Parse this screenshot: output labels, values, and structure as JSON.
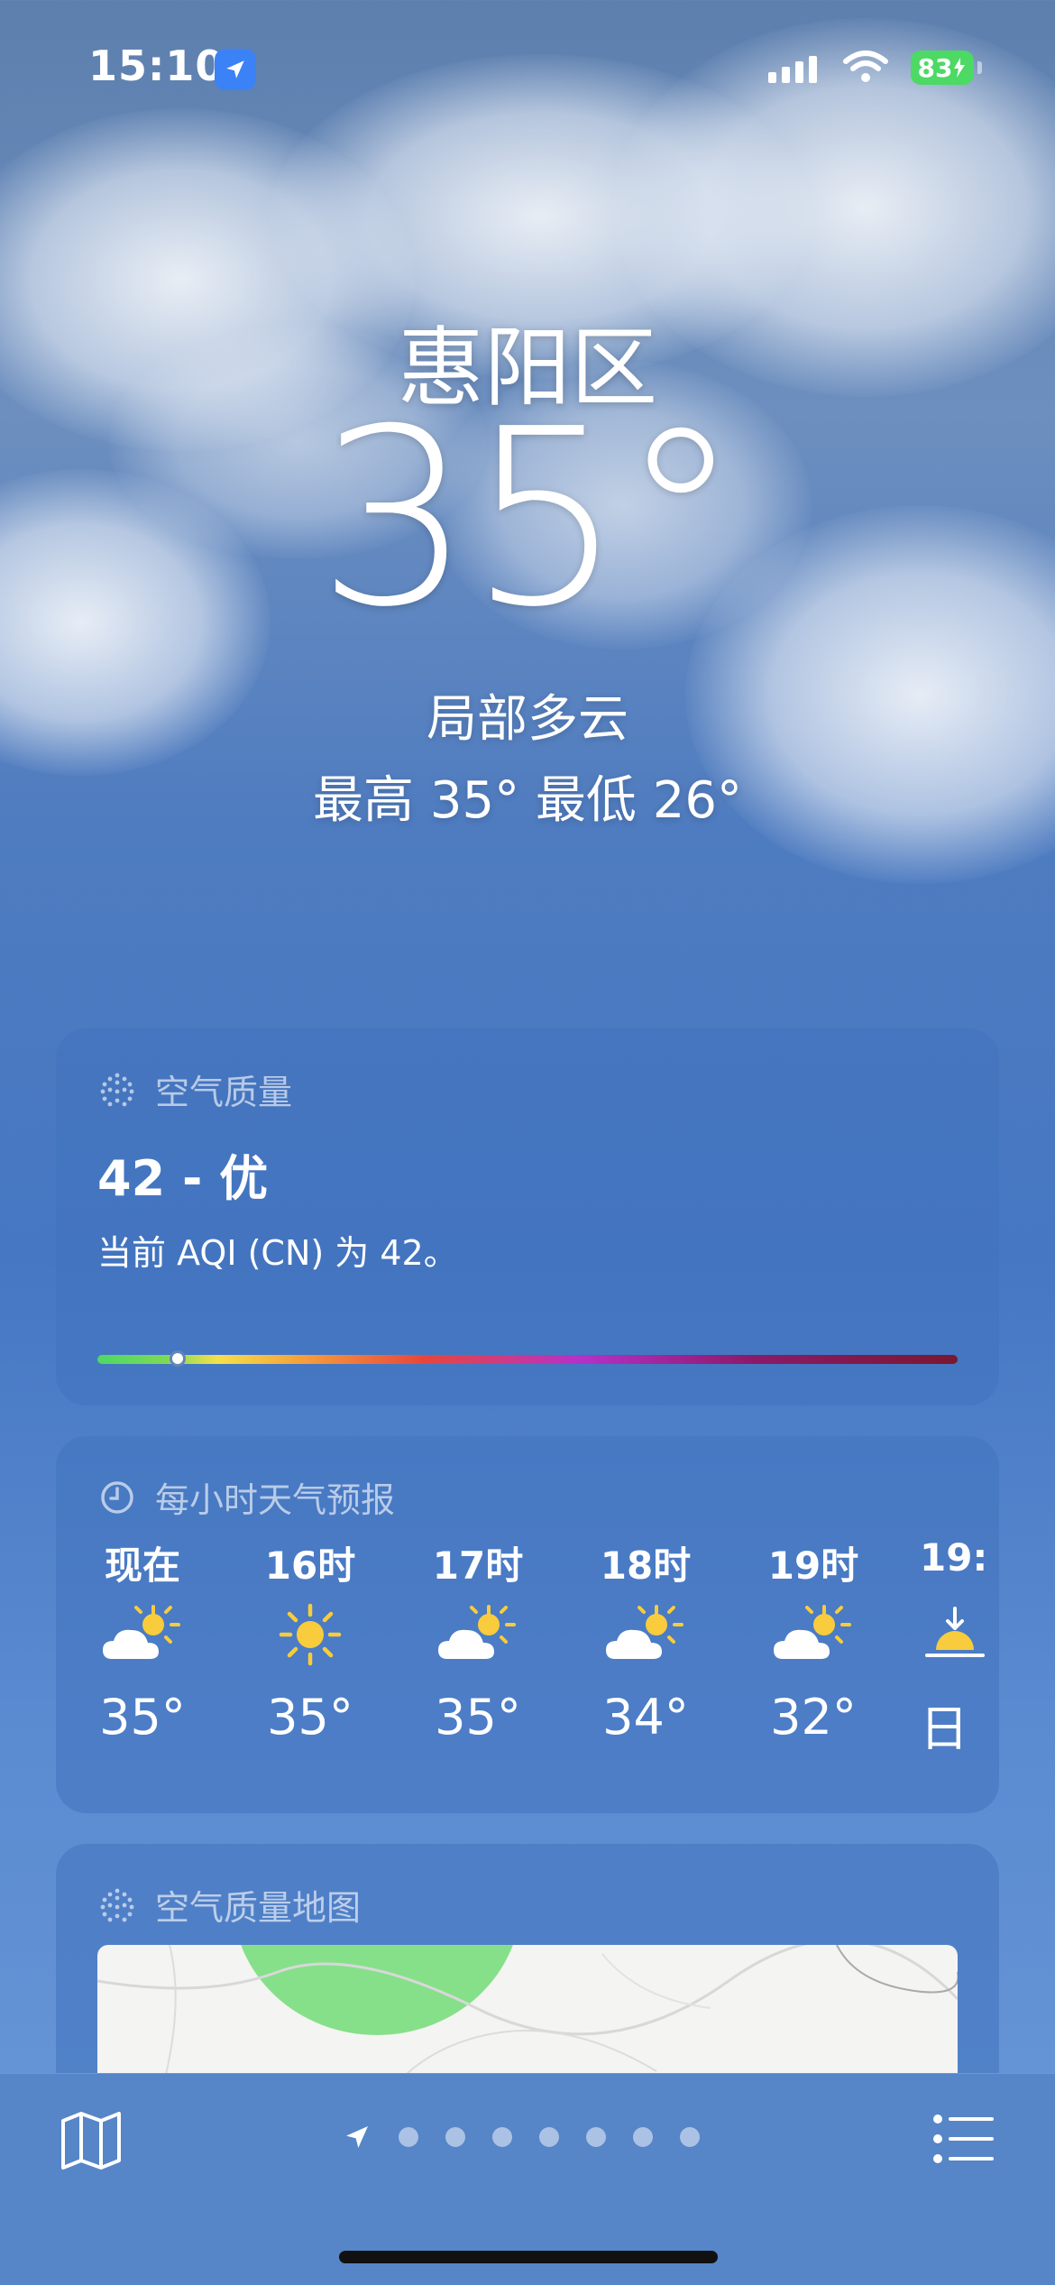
{
  "status_bar": {
    "time": "15:10",
    "battery": "83",
    "location_icon": "location-arrow-icon",
    "signal_icon": "cellular-signal-icon",
    "wifi_icon": "wifi-icon",
    "battery_icon": "battery-charging-icon",
    "battery_color": "#4cd964"
  },
  "current": {
    "city": "惠阳区",
    "temperature": "35°",
    "condition": "局部多云",
    "high_low": "最高 35°  最低 26°"
  },
  "air_quality": {
    "header": "空气质量",
    "icon": "air-quality-icon",
    "value": "42 - 优",
    "description": "当前 AQI (CN) 为 42。",
    "aqi": 42
  },
  "hourly": {
    "header": "每小时天气预报",
    "icon": "clock-icon",
    "items": [
      {
        "label": "现在",
        "icon": "partly-cloudy-icon",
        "temp": "35°"
      },
      {
        "label": "16时",
        "icon": "sun-icon",
        "temp": "35°"
      },
      {
        "label": "17时",
        "icon": "partly-cloudy-icon",
        "temp": "35°"
      },
      {
        "label": "18时",
        "icon": "partly-cloudy-icon",
        "temp": "34°"
      },
      {
        "label": "19时",
        "icon": "partly-cloudy-icon",
        "temp": "32°"
      },
      {
        "label": "19:",
        "icon": "sunset-icon",
        "temp": "日"
      }
    ]
  },
  "air_map": {
    "header": "空气质量地图",
    "icon": "air-quality-icon"
  },
  "toolbar": {
    "map_icon": "map-icon",
    "list_icon": "list-icon",
    "page_count": 7
  },
  "colors": {
    "accent": "#3b82f6",
    "aqi_good": "#4cd964",
    "sun": "#f8cc3c"
  }
}
